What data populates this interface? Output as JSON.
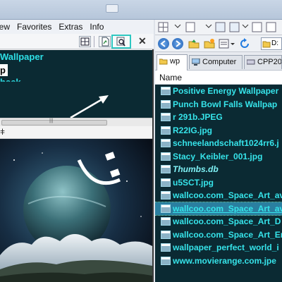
{
  "menu": [
    "iew",
    "Favorites",
    "Extras",
    "Info"
  ],
  "left_panel": {
    "line1": "Wallpaper",
    "line2": "p",
    "line3": "hack"
  },
  "right_panel": {
    "address": "D:",
    "tabs": [
      {
        "label": "wp",
        "active": true
      },
      {
        "label": "Computer",
        "active": false
      },
      {
        "label": "CPP20",
        "active": false
      }
    ],
    "column_header": "Name",
    "files": [
      {
        "name": "Positive Energy Wallpaper",
        "style": "normal"
      },
      {
        "name": "Punch Bowl Falls Wallpap",
        "style": "normal"
      },
      {
        "name": "r 291b.JPEG",
        "style": "normal"
      },
      {
        "name": "R22IG.jpg",
        "style": "normal"
      },
      {
        "name": "schneelandschaft1024rr6.j",
        "style": "normal"
      },
      {
        "name": "Stacy_Keibler_001.jpg",
        "style": "normal"
      },
      {
        "name": "Thumbs.db",
        "style": "italic"
      },
      {
        "name": "u5SCT.jpg",
        "style": "normal"
      },
      {
        "name": "wallcoo.com_Space_Art_av",
        "style": "normal"
      },
      {
        "name": "wallcoo.com_Space_Art_av",
        "style": "selected"
      },
      {
        "name": "wallcoo.com_Space_Art_D",
        "style": "normal"
      },
      {
        "name": "wallcoo.com_Space_Art_Er",
        "style": "normal"
      },
      {
        "name": "wallpaper_perfect_world_i",
        "style": "normal"
      },
      {
        "name": "www.movierange.com.jpe",
        "style": "normal"
      }
    ]
  },
  "colors": {
    "list_bg": "#0b2a33",
    "list_text": "#36e4ea",
    "highlight_box": "#2ec7c1",
    "selection": "#2a7fa0"
  }
}
